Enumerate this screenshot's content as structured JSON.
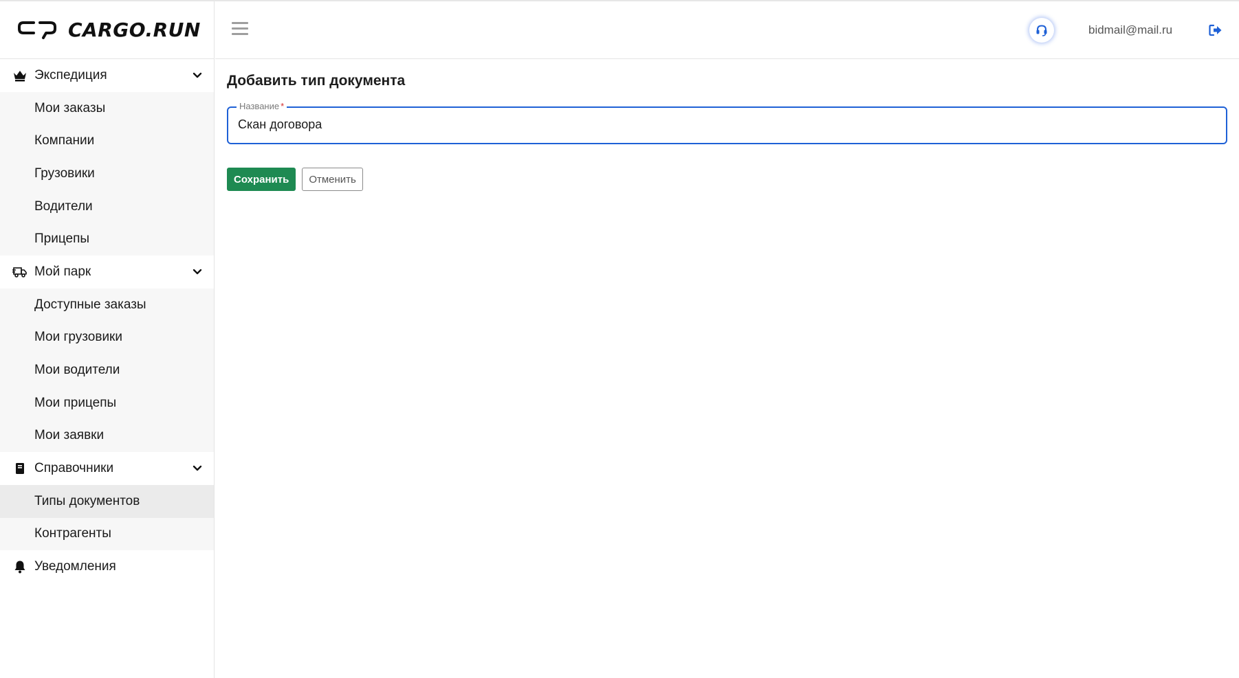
{
  "app": {
    "brand": "CARGO.RUN"
  },
  "header": {
    "user_email": "bidmail@mail.ru"
  },
  "sidebar": {
    "groups": [
      {
        "label": "Экспедиция",
        "icon": "crown-icon",
        "items": [
          "Мои заказы",
          "Компании",
          "Грузовики",
          "Водители",
          "Прицепы"
        ]
      },
      {
        "label": "Мой парк",
        "icon": "truck-icon",
        "items": [
          "Доступные заказы",
          "Мои грузовики",
          "Мои водители",
          "Мои прицепы",
          "Мои заявки"
        ]
      },
      {
        "label": "Справочники",
        "icon": "book-icon",
        "items": [
          "Типы документов",
          "Контрагенты"
        ],
        "active_item": "Типы документов"
      }
    ],
    "notifications": {
      "label": "Уведомления",
      "icon": "bell-icon"
    }
  },
  "main": {
    "title": "Добавить тип документа",
    "name_field": {
      "label": "Название",
      "required_mark": "*",
      "value": "Скан договора"
    },
    "save_label": "Сохранить",
    "cancel_label": "Отменить"
  },
  "colors": {
    "accent": "#1e60d6",
    "save": "#1e8a52",
    "required": "#d32f2f"
  }
}
